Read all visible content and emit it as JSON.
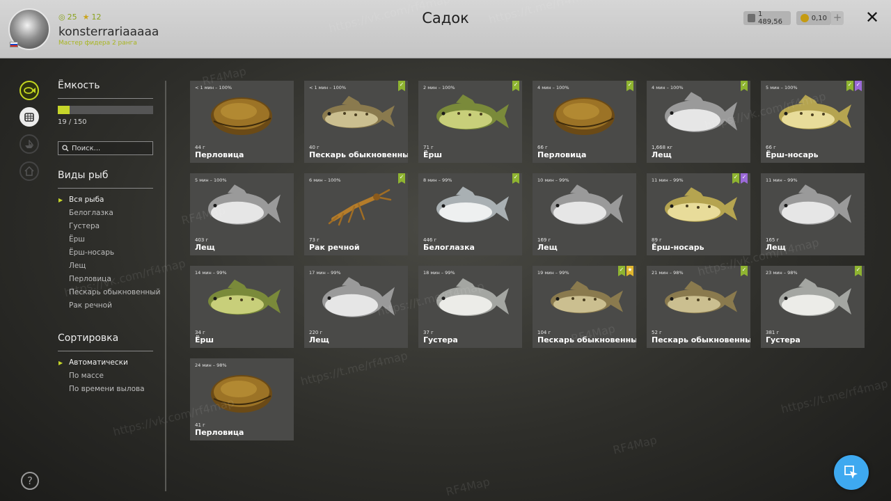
{
  "header": {
    "title": "Садок",
    "player": {
      "name": "konsterrariaaaaa",
      "rank": "Мастер фидера 2 ранга",
      "level": "25",
      "stars": "12"
    },
    "currency": {
      "silver": "1 489,56",
      "gold": "0,10",
      "add_label": "+"
    },
    "close_label": "✕"
  },
  "capacity": {
    "title": "Ёмкость",
    "text": "19 / 150",
    "fill_fraction": 0.127
  },
  "search": {
    "placeholder": "Поиск..."
  },
  "species": {
    "title": "Виды рыб",
    "items": [
      "Вся рыба",
      "Белоглазка",
      "Густера",
      "Ёрш",
      "Ёрш-носарь",
      "Лещ",
      "Перловица",
      "Пескарь обыкновенный",
      "Рак речной"
    ],
    "active_index": 0
  },
  "sorting": {
    "title": "Сортировка",
    "items": [
      "Автоматически",
      "По массе",
      "По времени вылова"
    ],
    "active_index": 0
  },
  "help_label": "?",
  "cursor_icon": "cursor-click-icon",
  "colors": {
    "accent": "#c6d62a",
    "badge_green": "#8fb431",
    "badge_purple": "#9b6ad8",
    "badge_gold": "#e1b72e",
    "action_blue": "#3ea9f0"
  },
  "fish_cards": [
    {
      "time": "< 1 мин – 100%",
      "weight": "44 г",
      "name": "Перловица",
      "kind": "mussel",
      "badges": []
    },
    {
      "time": "< 1 мин – 100%",
      "weight": "40 г",
      "name": "Пескарь обыкновенный",
      "kind": "gudgeon",
      "badges": [
        "green"
      ]
    },
    {
      "time": "2 мин – 100%",
      "weight": "71 г",
      "name": "Ёрш",
      "kind": "ruffe",
      "badges": [
        "green"
      ]
    },
    {
      "time": "4 мин – 100%",
      "weight": "66 г",
      "name": "Перловица",
      "kind": "mussel",
      "badges": [
        "green"
      ]
    },
    {
      "time": "4 мин – 100%",
      "weight": "1,668 кг",
      "name": "Лещ",
      "kind": "bream",
      "badges": [
        "green"
      ]
    },
    {
      "time": "5 мин – 100%",
      "weight": "66 г",
      "name": "Ёрш-носарь",
      "kind": "ruffe-nosar",
      "badges": [
        "green",
        "purple"
      ]
    },
    {
      "time": "5 мин – 100%",
      "weight": "403 г",
      "name": "Лещ",
      "kind": "bream",
      "badges": []
    },
    {
      "time": "6 мин – 100%",
      "weight": "73 г",
      "name": "Рак речной",
      "kind": "crayfish",
      "badges": [
        "green"
      ]
    },
    {
      "time": "8 мин – 99%",
      "weight": "446 г",
      "name": "Белоглазка",
      "kind": "white-eye",
      "badges": [
        "green"
      ]
    },
    {
      "time": "10 мин – 99%",
      "weight": "169 г",
      "name": "Лещ",
      "kind": "bream",
      "badges": []
    },
    {
      "time": "11 мин – 99%",
      "weight": "89 г",
      "name": "Ёрш-носарь",
      "kind": "ruffe-nosar",
      "badges": [
        "green",
        "purple"
      ]
    },
    {
      "time": "11 мин – 99%",
      "weight": "165 г",
      "name": "Лещ",
      "kind": "bream",
      "badges": []
    },
    {
      "time": "14 мин – 99%",
      "weight": "34 г",
      "name": "Ёрш",
      "kind": "ruffe",
      "badges": []
    },
    {
      "time": "17 мин – 99%",
      "weight": "220 г",
      "name": "Лещ",
      "kind": "bream",
      "badges": []
    },
    {
      "time": "18 мин – 99%",
      "weight": "37 г",
      "name": "Густера",
      "kind": "silver-bream",
      "badges": []
    },
    {
      "time": "19 мин – 99%",
      "weight": "104 г",
      "name": "Пескарь обыкновенный",
      "kind": "gudgeon",
      "badges": [
        "green",
        "gold"
      ]
    },
    {
      "time": "21 мин – 98%",
      "weight": "52 г",
      "name": "Пескарь обыкновенный",
      "kind": "gudgeon",
      "badges": [
        "green"
      ]
    },
    {
      "time": "23 мин – 98%",
      "weight": "381 г",
      "name": "Густера",
      "kind": "silver-bream",
      "badges": [
        "green"
      ]
    },
    {
      "time": "24 мин – 98%",
      "weight": "41 г",
      "name": "Перловица",
      "kind": "mussel",
      "badges": []
    }
  ],
  "watermarks": [
    "RF4Map",
    "https://vk.com/rf4map",
    "https://t.me/rf4map"
  ]
}
